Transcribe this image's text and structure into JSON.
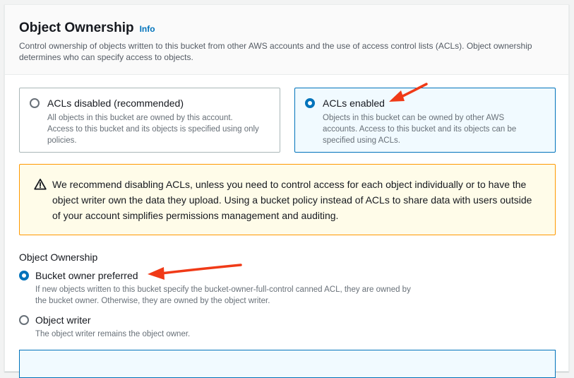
{
  "header": {
    "title": "Object Ownership",
    "info_label": "Info",
    "description": "Control ownership of objects written to this bucket from other AWS accounts and the use of access control lists (ACLs). Object ownership determines who can specify access to objects."
  },
  "acl_options": [
    {
      "label": "ACLs disabled (recommended)",
      "description": "All objects in this bucket are owned by this account. Access to this bucket and its objects is specified using only policies.",
      "selected": false
    },
    {
      "label": "ACLs enabled",
      "description": "Objects in this bucket can be owned by other AWS accounts. Access to this bucket and its objects can be specified using ACLs.",
      "selected": true
    }
  ],
  "warning": {
    "icon": "warning-icon",
    "text": "We recommend disabling ACLs, unless you need to control access for each object individually or to have the object writer own the data they upload. Using a bucket policy instead of ACLs to share data with users outside of your account simplifies permissions management and auditing."
  },
  "ownership": {
    "section_label": "Object Ownership",
    "options": [
      {
        "label": "Bucket owner preferred",
        "description": "If new objects written to this bucket specify the bucket-owner-full-control canned ACL, they are owned by the bucket owner. Otherwise, they are owned by the object writer.",
        "selected": true
      },
      {
        "label": "Object writer",
        "description": "The object writer remains the object owner.",
        "selected": false
      }
    ]
  },
  "colors": {
    "accent": "#0073bb",
    "warning_border": "#ff9900",
    "warning_bg": "#fffce9",
    "annotation_arrow": "#f03a17"
  }
}
